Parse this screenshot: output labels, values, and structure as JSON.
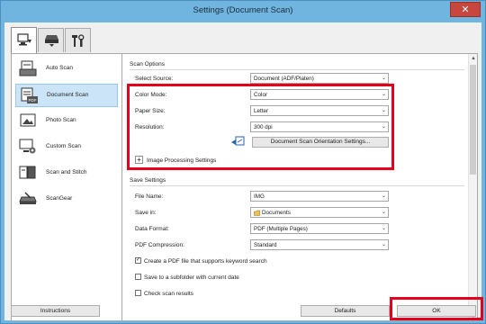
{
  "window": {
    "title": "Settings (Document Scan)",
    "close_glyph": "✕"
  },
  "tabs": [
    {
      "name": "scan-from-computer-icon"
    },
    {
      "name": "scan-from-operation-panel-icon"
    },
    {
      "name": "general-settings-icon"
    }
  ],
  "nav": [
    {
      "label": "Auto Scan",
      "icon": "auto-scan-icon"
    },
    {
      "label": "Document Scan",
      "icon": "document-scan-icon"
    },
    {
      "label": "Photo Scan",
      "icon": "photo-scan-icon"
    },
    {
      "label": "Custom Scan",
      "icon": "custom-scan-icon"
    },
    {
      "label": "Scan and Stitch",
      "icon": "scan-and-stitch-icon"
    },
    {
      "label": "ScanGear",
      "icon": "scangear-icon"
    }
  ],
  "scan_options": {
    "title": "Scan Options",
    "select_source": {
      "label": "Select Source:",
      "value": "Document (ADF/Platen)"
    },
    "color_mode": {
      "label": "Color Mode:",
      "value": "Color"
    },
    "paper_size": {
      "label": "Paper Size:",
      "value": "Letter"
    },
    "resolution": {
      "label": "Resolution:",
      "value": "300 dpi"
    },
    "orientation_button": "Document Scan Orientation Settings...",
    "image_processing": {
      "expander": "+",
      "label": "Image Processing Settings"
    }
  },
  "save_settings": {
    "title": "Save Settings",
    "file_name": {
      "label": "File Name:",
      "value": "IMG"
    },
    "save_in": {
      "label": "Save in:",
      "value": "Documents"
    },
    "data_format": {
      "label": "Data Format:",
      "value": "PDF (Multiple Pages)"
    },
    "pdf_compression": {
      "label": "PDF Compression:",
      "value": "Standard"
    },
    "checkboxes": [
      {
        "label": "Create a PDF file that supports keyword search",
        "checked": true,
        "mark": "✓"
      },
      {
        "label": "Save to a subfolder with current date",
        "checked": false,
        "mark": ""
      },
      {
        "label": "Check scan results",
        "checked": false,
        "mark": ""
      }
    ]
  },
  "footer": {
    "instructions": "Instructions",
    "defaults": "Defaults",
    "ok": "OK"
  },
  "dropdown_arrow": "⌄",
  "colors": {
    "highlight": "#e4001c",
    "titlebar": "#6fb5e0",
    "selection": "#cce4f7"
  }
}
